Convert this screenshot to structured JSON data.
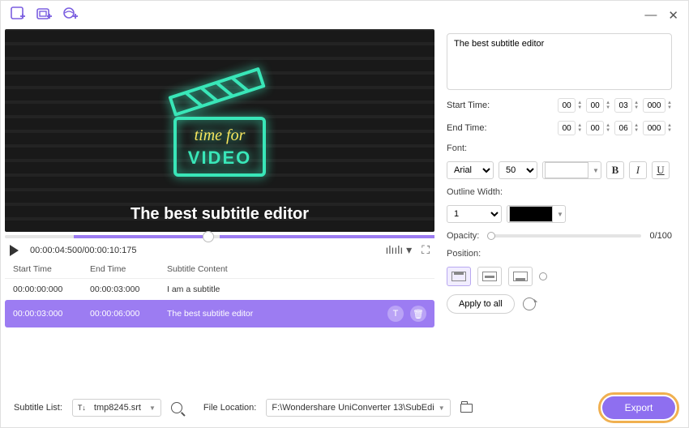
{
  "title_icons": [
    "add-file-icon",
    "add-folder-icon",
    "url-import-icon"
  ],
  "video": {
    "overlay_text": "The best subtitle editor"
  },
  "playback": {
    "time_display": "00:00:04:500/00:00:10:175"
  },
  "subtitle_headers": {
    "start": "Start Time",
    "end": "End Time",
    "content": "Subtitle Content"
  },
  "subtitles": [
    {
      "start": "00:00:00:000",
      "end": "00:00:03:000",
      "text": "I am a subtitle",
      "selected": false
    },
    {
      "start": "00:00:03:000",
      "end": "00:00:06:000",
      "text": "The best subtitle editor",
      "selected": true
    }
  ],
  "subtitle_list_label": "Subtitle List:",
  "subtitle_file": "tmp8245.srt",
  "file_location_label": "File Location:",
  "file_location": "F:\\Wondershare UniConverter 13\\SubEdi",
  "export_label": "Export",
  "caption_text": "The best subtitle editor",
  "start_time_label": "Start Time:",
  "start_time": {
    "hh": "00",
    "mm": "00",
    "ss": "03",
    "ms": "000"
  },
  "end_time_label": "End Time:",
  "end_time": {
    "hh": "00",
    "mm": "00",
    "ss": "06",
    "ms": "000"
  },
  "font_label": "Font:",
  "font_family": "Arial",
  "font_size": "50",
  "font_color": "#ffffff",
  "outline_label": "Outline Width:",
  "outline_width": "1",
  "outline_color": "#000000",
  "opacity_label": "Opacity:",
  "opacity_value": "0/100",
  "position_label": "Position:",
  "apply_all_label": "Apply to all"
}
